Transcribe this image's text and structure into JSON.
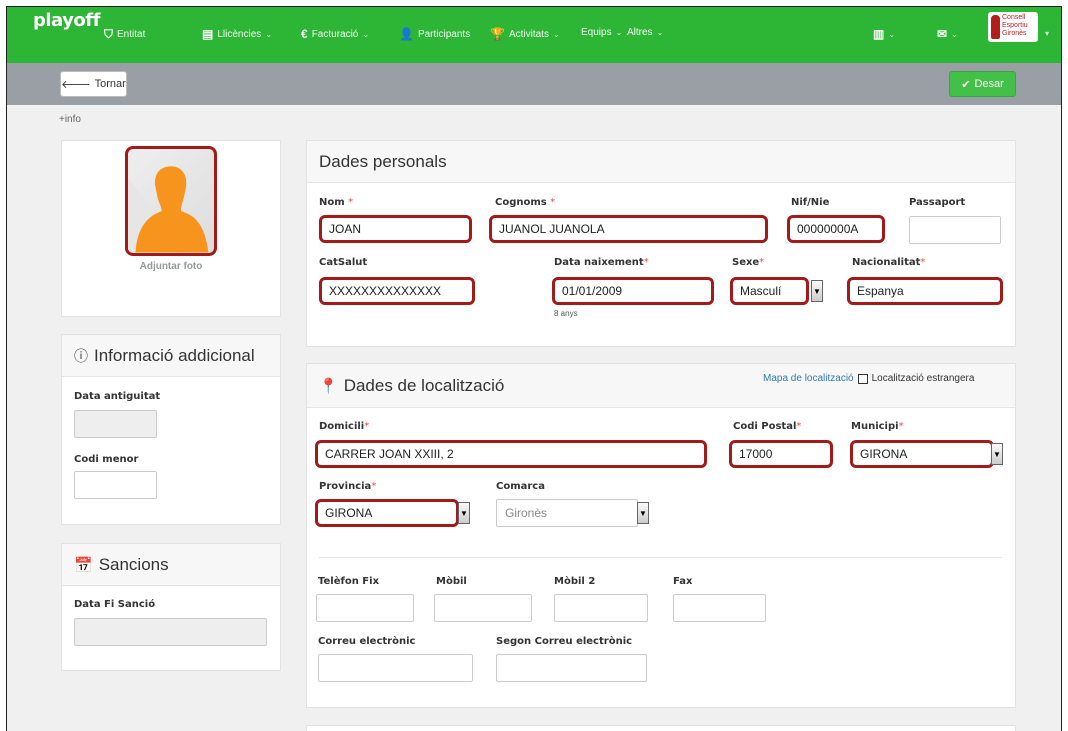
{
  "nav": {
    "brand": "playoff",
    "items": [
      {
        "label": "Entitat",
        "icon": "shield-icon",
        "glyph": "⛉",
        "caret": false
      },
      {
        "label": "Llicències",
        "icon": "id-card-icon",
        "glyph": "▤",
        "caret": true
      },
      {
        "label": "Facturació",
        "icon": "euro-icon",
        "glyph": "€",
        "caret": true
      },
      {
        "label": "Participants",
        "icon": "user-icon",
        "glyph": "👤",
        "caret": false
      },
      {
        "label": "Activitats",
        "icon": "trophy-icon",
        "glyph": "🏆",
        "caret": true
      },
      {
        "label": "Equips",
        "icon": "",
        "glyph": "",
        "caret": true
      },
      {
        "label": "Altres",
        "icon": "",
        "glyph": "",
        "caret": true
      }
    ],
    "logo_text": "Consell Esportiu Gironès"
  },
  "toolbar": {
    "back_label": "Tornar",
    "save_label": "Desar"
  },
  "info_link": "+info",
  "photo": {
    "label": "Adjuntar foto"
  },
  "additional": {
    "title": "Informació addicional",
    "fields": {
      "seniority": "Data antiguitat",
      "minor_code": "Codi menor"
    }
  },
  "sanctions": {
    "title": "Sancions",
    "end_date_label": "Data Fi Sanció"
  },
  "personal": {
    "title": "Dades personals",
    "labels": {
      "name": "Nom",
      "surnames": "Cognoms",
      "nif": "Nif/Nie",
      "passport": "Passaport",
      "catsalut": "CatSalut",
      "birth": "Data naixement",
      "sex": "Sexe",
      "nationality": "Nacionalitat"
    },
    "values": {
      "name": "JOAN",
      "surnames": "JUANOL JUANOLA",
      "nif": "00000000A",
      "passport": "",
      "catsalut": "XXXXXXXXXXXXXX",
      "birth": "01/01/2009",
      "sex": "Masculí",
      "nationality": "Espanya"
    },
    "age_note": "8 anys",
    "required_mark": "*"
  },
  "location": {
    "title": "Dades de localització",
    "map_link": "Mapa de localització",
    "foreign_label": "Localització estrangera",
    "labels": {
      "address": "Domicili",
      "postal": "Codi Postal",
      "municipality": "Municipi",
      "province": "Provincia",
      "county": "Comarca",
      "phone": "Telèfon Fix",
      "mobile": "Mòbil",
      "mobile2": "Mòbil 2",
      "fax": "Fax",
      "email": "Correu electrònic",
      "email2": "Segon Correu electrònic"
    },
    "values": {
      "address": "CARRER JOAN XXIII, 2",
      "postal": "17000",
      "municipality": "GIRONA",
      "province": "GIRONA",
      "county": "Gironès"
    }
  },
  "colors": {
    "navbar": "#2db535",
    "highlight": "#a21a1a",
    "save": "#43c047"
  }
}
